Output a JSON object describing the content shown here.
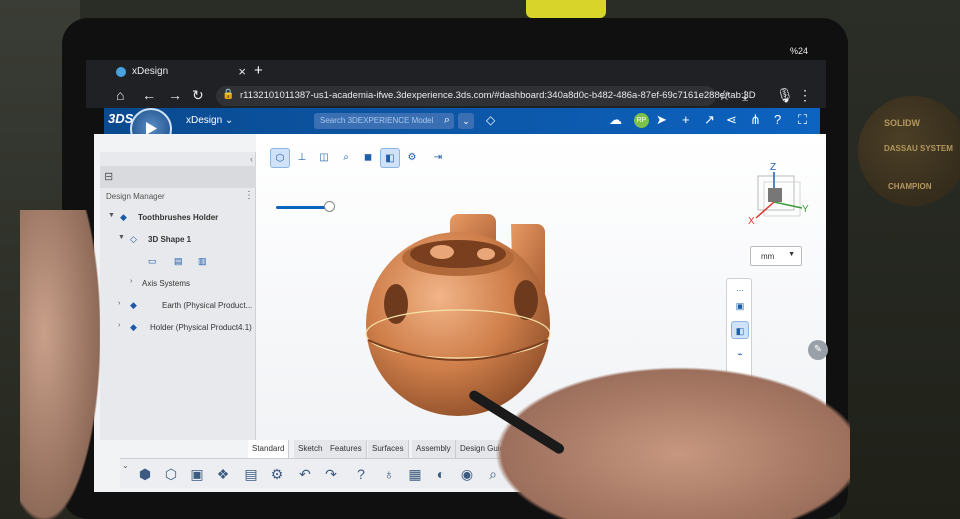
{
  "status_bar": {
    "battery": "%24"
  },
  "browser": {
    "tab_title": "xDesign",
    "tab_close": "×",
    "new_tab": "+",
    "url": "r1132101011387-us1-academia-ifwe.3dexperience.3ds.com/#dashboard:340a8d0c-b482-486a-87ef-69c7161e288e/tab:3D"
  },
  "app_header": {
    "brand_mark": "3DS",
    "app_name": "xDesign ⌄",
    "search_placeholder": "Search 3DEXPERIENCE Model",
    "avatar_initials": "RP"
  },
  "tree": {
    "title": "Design Manager",
    "items": [
      {
        "label": "Toothbrushes Holder",
        "arrow": "▼",
        "icon": "◆"
      },
      {
        "label": "3D Shape 1",
        "arrow": "▼",
        "icon": "◇"
      },
      {
        "label": "Axis Systems",
        "arrow": "›",
        "icon": ""
      },
      {
        "label": "Earth (Physical Product...",
        "arrow": "›",
        "icon": "◆"
      },
      {
        "label": "Holder (Physical Product4.1)",
        "arrow": "›",
        "icon": "◆"
      }
    ]
  },
  "viewport": {
    "unit": "mm",
    "triad_axes": {
      "z": "Z",
      "x": "X",
      "y": "Y"
    }
  },
  "section_tabs": [
    "Standard",
    "Sketch",
    "Features",
    "Surfaces",
    "Assembly",
    "Design Guidance"
  ],
  "active_section_tab": "Standard",
  "sticker": {
    "line1": "SOLIDW",
    "line2": "DASSAU SYSTEM",
    "line3": "CHAMPION"
  }
}
